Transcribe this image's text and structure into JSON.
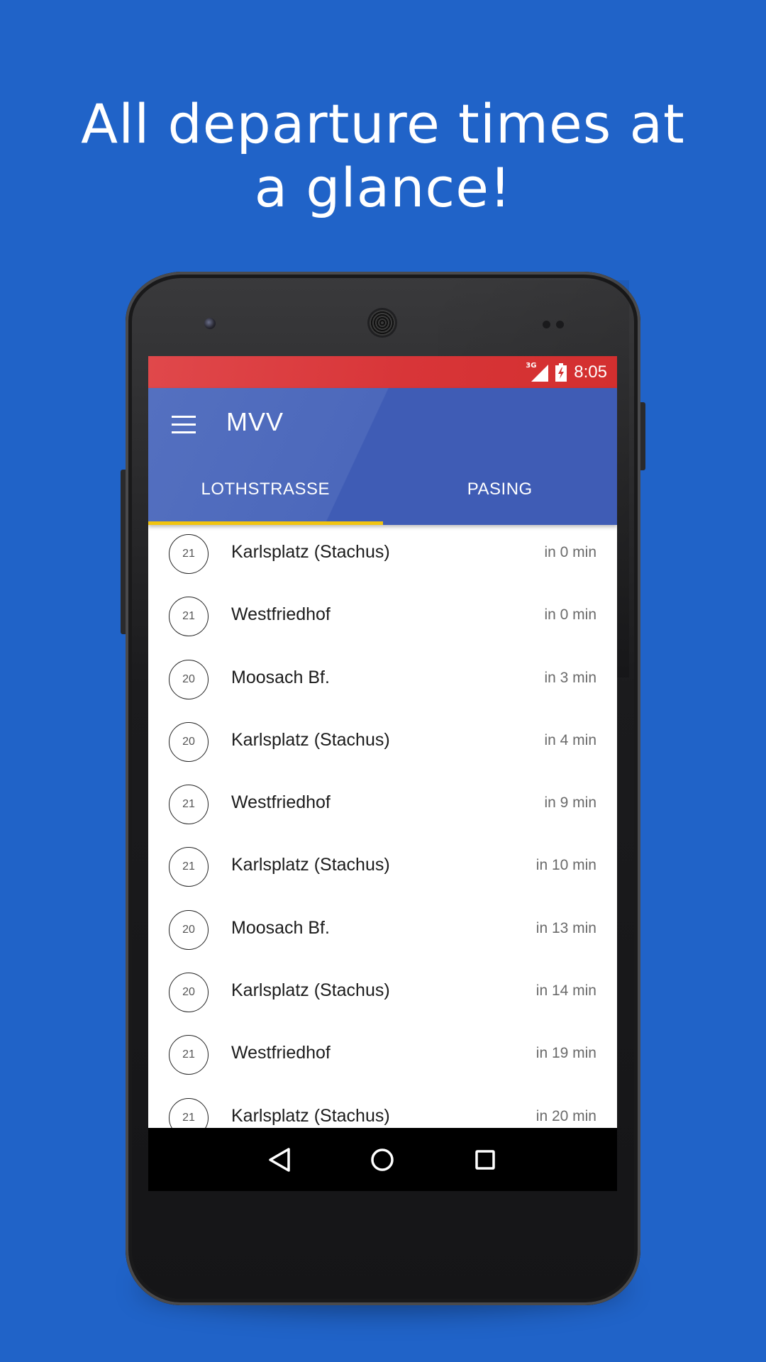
{
  "headline": {
    "line1": "All departure times at",
    "line2": "a glance!"
  },
  "status_bar": {
    "network": "3G",
    "time": "8:05",
    "icons": [
      "signal-icon",
      "battery-charging-icon"
    ]
  },
  "app_bar": {
    "title": "MVV",
    "menu_icon": "hamburger-menu-icon"
  },
  "tabs": [
    {
      "label": "LOTHSTRASSE",
      "active": true
    },
    {
      "label": "PASING",
      "active": false
    }
  ],
  "departures": [
    {
      "line": "21",
      "destination": "Karlsplatz (Stachus)",
      "eta": "in 0 min"
    },
    {
      "line": "21",
      "destination": "Westfriedhof",
      "eta": "in 0 min"
    },
    {
      "line": "20",
      "destination": "Moosach Bf.",
      "eta": "in 3 min"
    },
    {
      "line": "20",
      "destination": "Karlsplatz (Stachus)",
      "eta": "in 4 min"
    },
    {
      "line": "21",
      "destination": "Westfriedhof",
      "eta": "in 9 min"
    },
    {
      "line": "21",
      "destination": "Karlsplatz (Stachus)",
      "eta": "in 10 min"
    },
    {
      "line": "20",
      "destination": "Moosach Bf.",
      "eta": "in 13 min"
    },
    {
      "line": "20",
      "destination": "Karlsplatz (Stachus)",
      "eta": "in 14 min"
    },
    {
      "line": "21",
      "destination": "Westfriedhof",
      "eta": "in 19 min"
    },
    {
      "line": "21",
      "destination": "Karlsplatz (Stachus)",
      "eta": "in 20 min"
    }
  ],
  "nav_bar": {
    "icons": [
      "back-icon",
      "home-icon",
      "recents-icon"
    ]
  },
  "colors": {
    "background": "#2063c8",
    "status_bar": "#d32f2f",
    "app_bar": "#3f5cb5",
    "tab_indicator": "#f1c40f"
  }
}
